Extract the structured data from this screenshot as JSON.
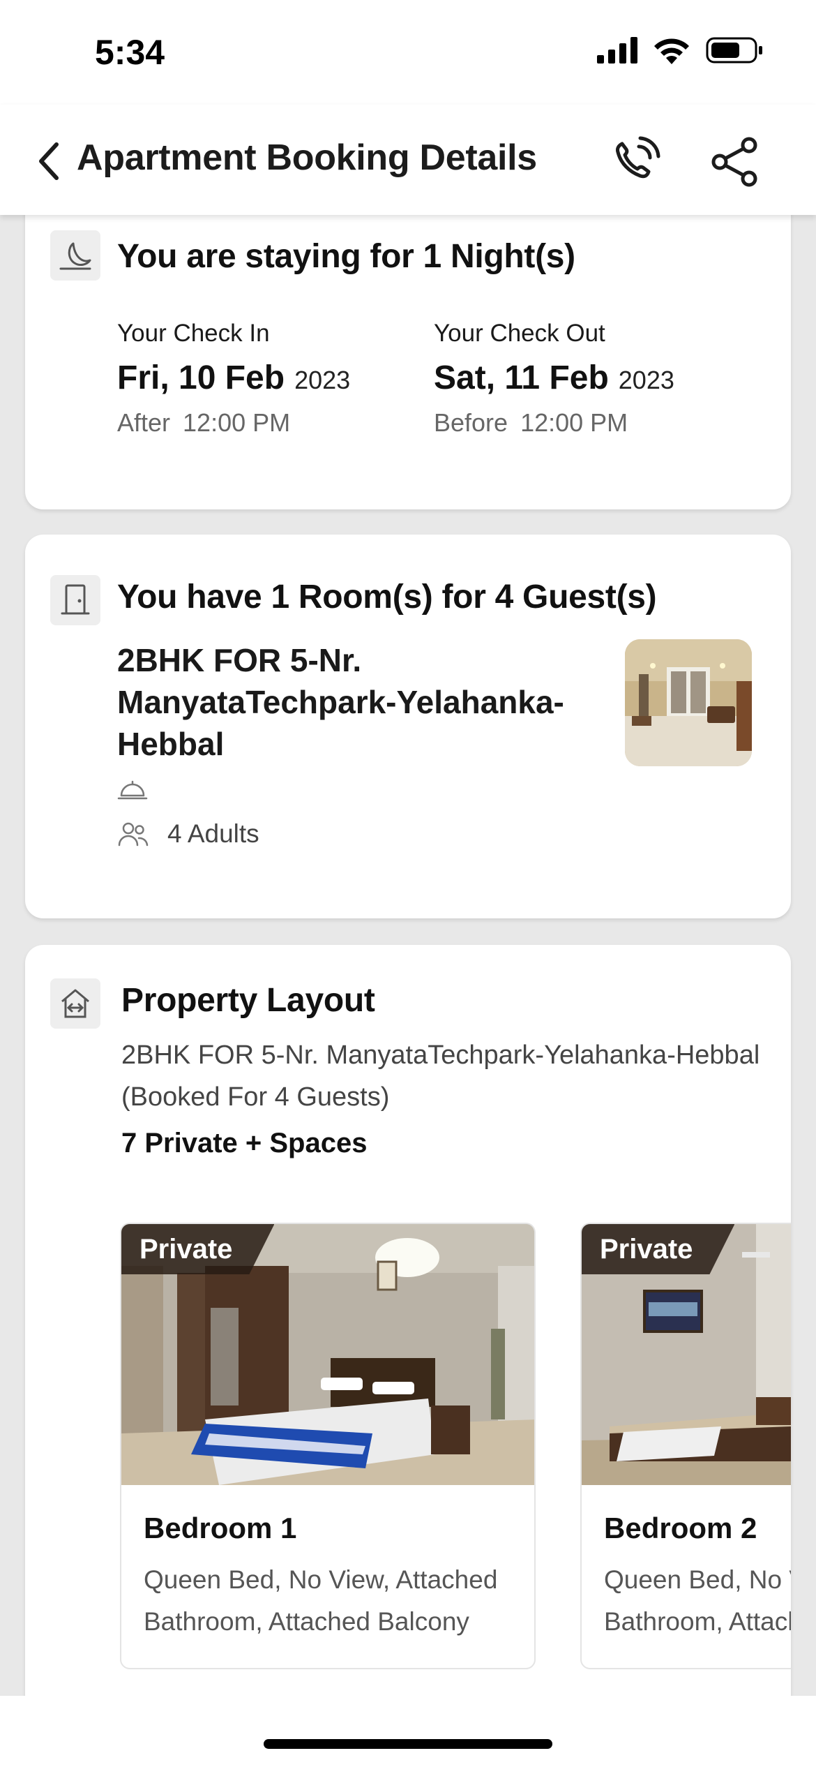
{
  "status_bar": {
    "time": "5:34"
  },
  "header": {
    "title": "Apartment Booking Details"
  },
  "stay_card": {
    "heading": "You are staying for 1 Night(s)",
    "check_in": {
      "label": "Your Check In",
      "date": "Fri, 10 Feb",
      "year": "2023",
      "prefix": "After",
      "time": "12:00 PM"
    },
    "check_out": {
      "label": "Your Check Out",
      "date": "Sat, 11 Feb",
      "year": "2023",
      "prefix": "Before",
      "time": "12:00 PM"
    }
  },
  "room_card": {
    "heading": "You have 1 Room(s) for 4 Guest(s)",
    "property_name": "2BHK FOR 5-Nr. ManyataTechpark-Yelahanka-Hebbal",
    "guests": "4 Adults"
  },
  "layout_card": {
    "heading": "Property Layout",
    "property_name": "2BHK FOR 5-Nr. ManyataTechpark-Yelahanka-Hebbal",
    "booked_for": "(Booked For 4 Guests)",
    "spaces_count": "7 Private + Spaces",
    "spaces": [
      {
        "tag": "Private",
        "title": "Bedroom 1",
        "description": "Queen Bed, No View, Attached Bathroom, Attached Balcony"
      },
      {
        "tag": "Private",
        "title": "Bedroom 2",
        "description": "Queen Bed, No View, Attached Bathroom, Attached Balcony"
      }
    ]
  }
}
